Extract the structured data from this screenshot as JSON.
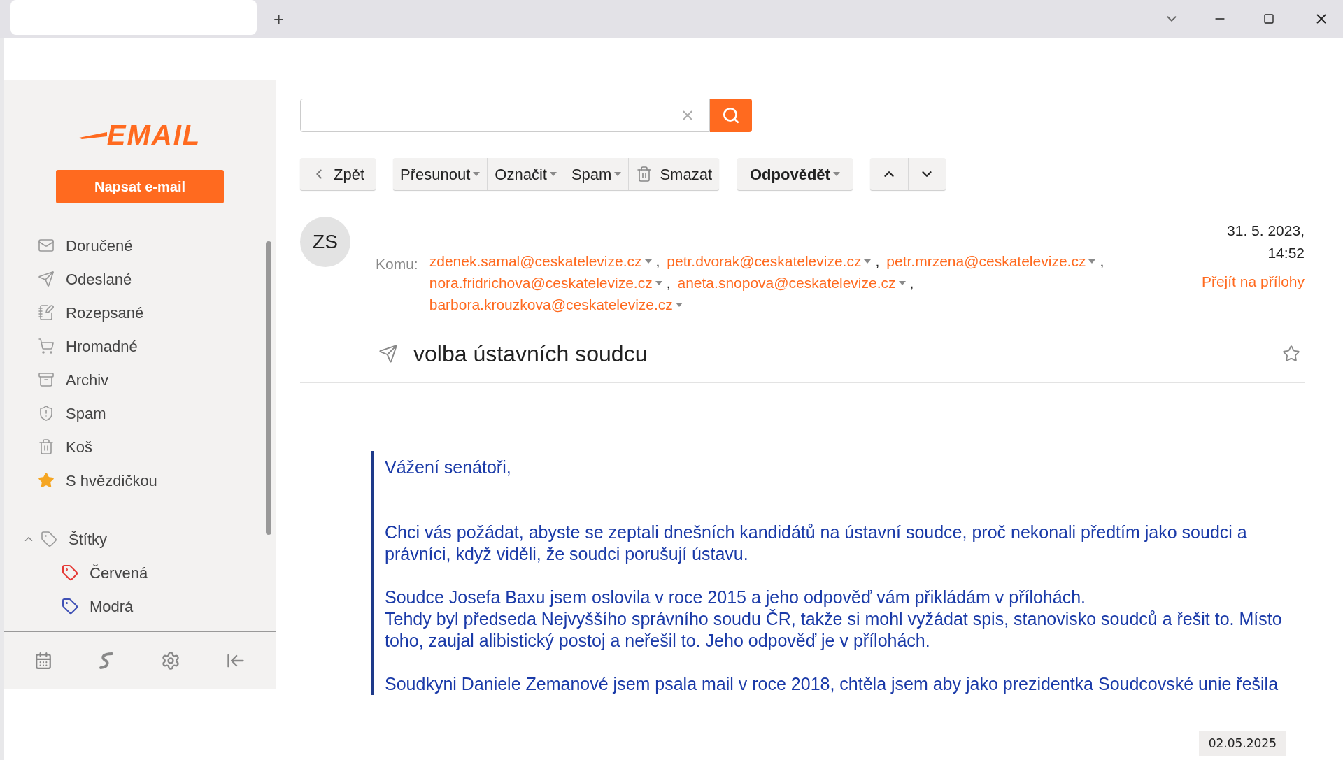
{
  "browser": {
    "new_tab": "+"
  },
  "sidebar": {
    "logo": "EMAIL",
    "compose": "Napsat e-mail",
    "folders": [
      {
        "label": "Doručené"
      },
      {
        "label": "Odeslané"
      },
      {
        "label": "Rozepsané"
      },
      {
        "label": "Hromadné"
      },
      {
        "label": "Archiv"
      },
      {
        "label": "Spam"
      },
      {
        "label": "Koš"
      },
      {
        "label": "S hvězdičkou"
      }
    ],
    "labels": {
      "label": "Štítky",
      "expanded": true,
      "children": [
        {
          "label": "Červená",
          "color": "#e53935"
        },
        {
          "label": "Modrá",
          "color": "#3f51b5"
        }
      ]
    }
  },
  "toolbar": {
    "back": "Zpět",
    "actions": [
      {
        "label": "Přesunout",
        "kind": "menu"
      },
      {
        "label": "Označit",
        "kind": "menu"
      },
      {
        "label": "Spam",
        "kind": "menu"
      },
      {
        "label": "Smazat",
        "kind": "delete"
      }
    ],
    "reply": "Odpovědět"
  },
  "message": {
    "avatar": "ZS",
    "to_label": "Komu:",
    "recipients": [
      {
        "email": "zdenek.samal@ceskatelevize.cz",
        "separator": ","
      },
      {
        "email": "petr.dvorak@ceskatelevize.cz",
        "separator": ","
      },
      {
        "email": "petr.mrzena@ceskatelevize.cz",
        "separator": ","
      },
      {
        "email": "nora.fridrichova@ceskatelevize.cz",
        "separator": ","
      },
      {
        "email": "aneta.snopova@ceskatelevize.cz",
        "separator": ","
      },
      {
        "email": "barbora.krouzkova@ceskatelevize.cz"
      }
    ],
    "date": "31. 5. 2023,",
    "time": "14:52",
    "attachments_link": "Přejít na přílohy",
    "subject": "volba ústavních soudcu",
    "starred": false,
    "body": [
      {
        "lines": [
          "Vážení senátoři,"
        ]
      },
      {
        "lines": [
          "Chci vás požádat, abyste se zeptali dnešních kandidátů na ústavní soudce, proč nekonali předtím jako soudci a",
          "právníci, když viděli, že soudci porušují ústavu."
        ]
      },
      {
        "lines": [
          "Soudce Josefa Baxu jsem oslovila v roce 2015 a jeho odpověď vám přikládám v přílohách.",
          "Tehdy byl předseda Nejvyššího správního soudu ČR, takže si mohl vyžádat spis, stanovisko soudců a řešit to. Místo",
          "toho, zaujal alibistický postoj a neřešil to. Jeho odpověď je v přílohách."
        ]
      },
      {
        "lines": [
          "Soudkyni Daniele Zemanové jsem psala mail v roce 2018, chtěla jsem aby jako prezidentka Soudcovské unie řešila"
        ]
      }
    ]
  },
  "stamp": "02.05.2025"
}
